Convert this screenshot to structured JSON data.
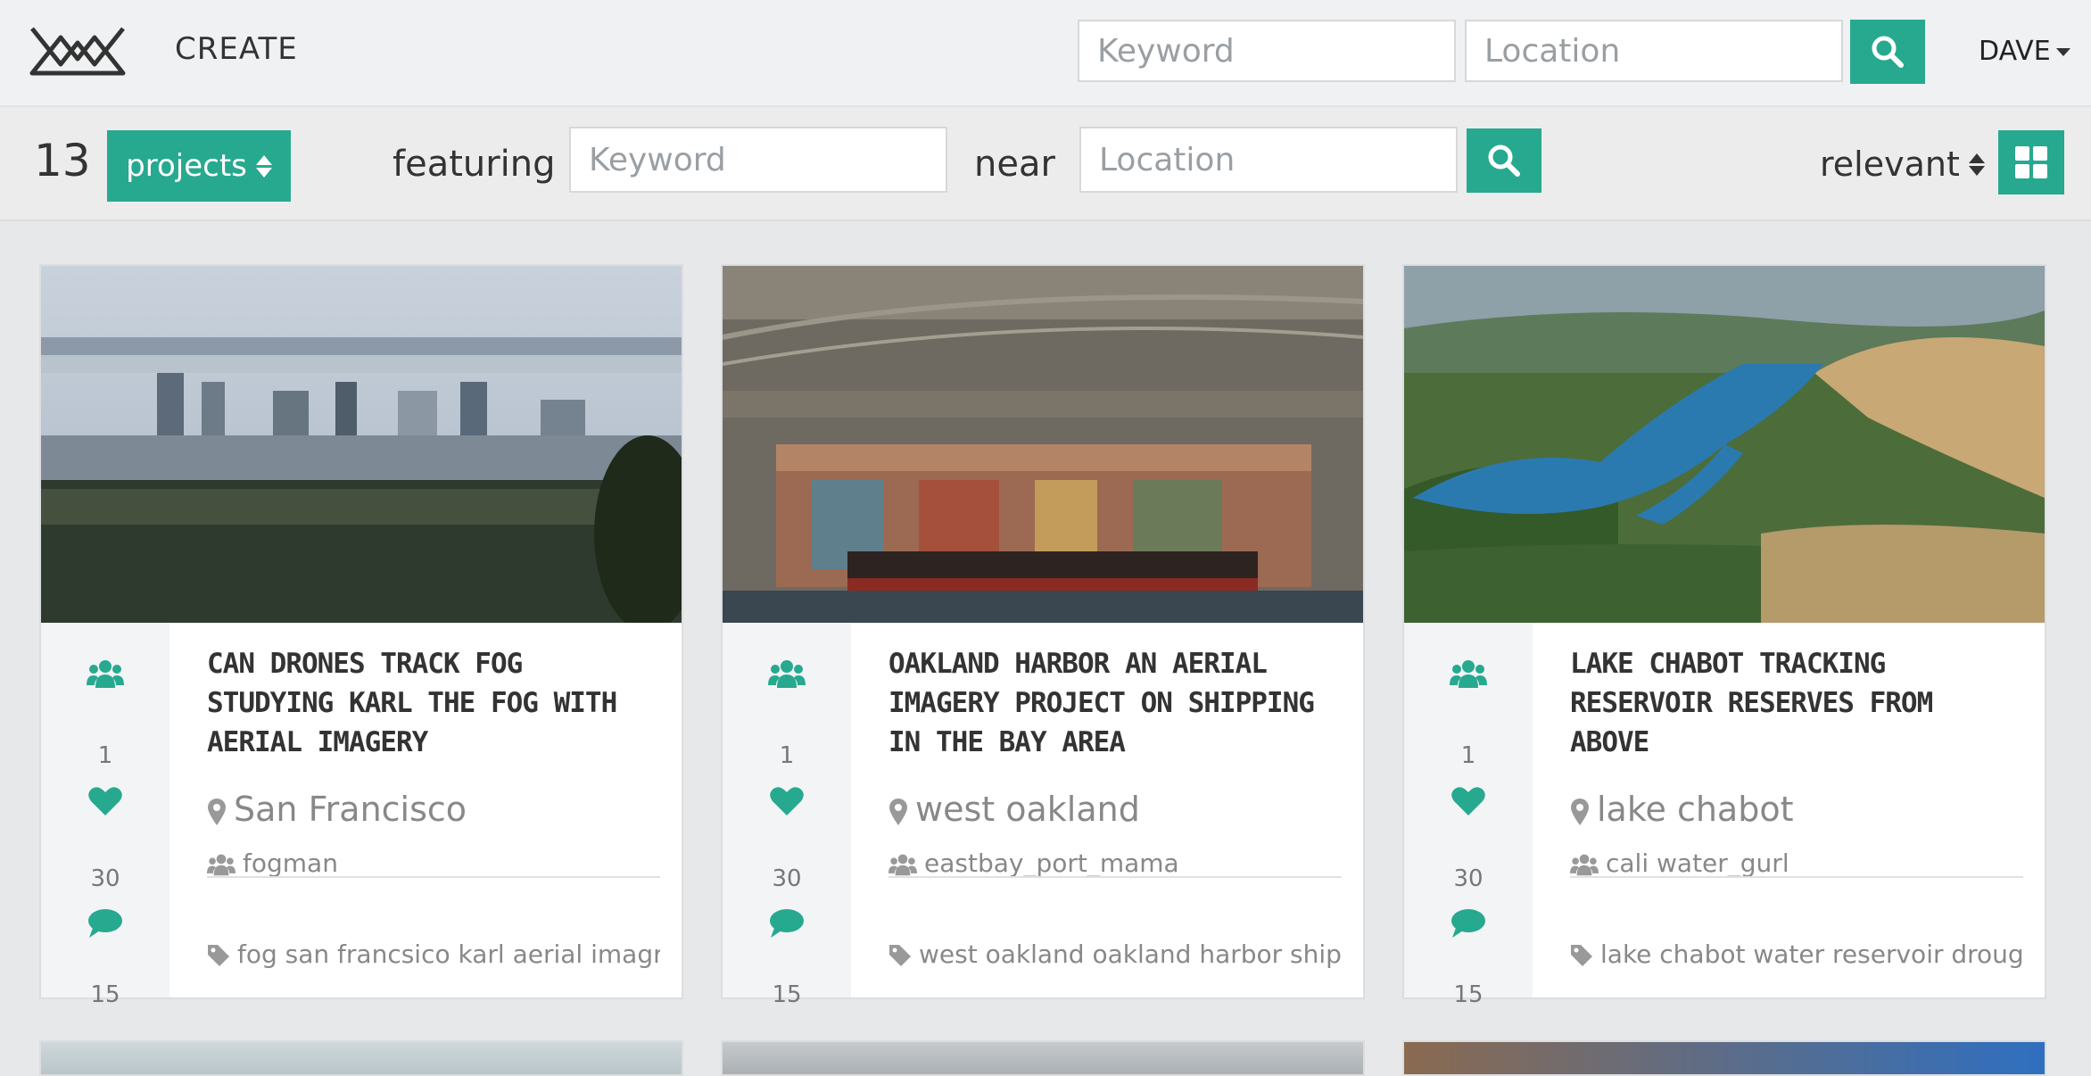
{
  "header": {
    "create_label": "CREATE",
    "search_keyword_placeholder": "Keyword",
    "search_location_placeholder": "Location",
    "user_label": "DAVE"
  },
  "filters": {
    "result_count": "13",
    "type_label": "projects",
    "featuring_label": "featuring",
    "keyword_placeholder": "Keyword",
    "near_label": "near",
    "location_placeholder": "Location",
    "sort_label": "relevant"
  },
  "colors": {
    "accent": "#27a98f",
    "background": "#e7e8e9"
  },
  "cards": [
    {
      "title": "Can drones track fog studying karl the fog with aerial imagery",
      "members": "1",
      "likes": "30",
      "comments": "15",
      "location": "San Francisco",
      "user": "fogman",
      "tags": "fog san francsico karl aerial imagry"
    },
    {
      "title": "Oakland harbor an aerial imagery project on shipping in the bay area",
      "members": "1",
      "likes": "30",
      "comments": "15",
      "location": "west oakland",
      "user": "eastbay_port_mama",
      "tags": "west oakland oakland harbor shipping"
    },
    {
      "title": "Lake chabot tracking reservoir reserves from above",
      "members": "1",
      "likes": "30",
      "comments": "15",
      "location": "lake chabot",
      "user": "cali water_gurl",
      "tags": "lake chabot water reservoir drought california"
    }
  ],
  "icons": {
    "logo": "mountain-logo-icon",
    "search": "search-icon",
    "members": "users-icon",
    "likes": "heart-icon",
    "comments": "comment-icon",
    "location": "map-marker-icon",
    "user": "users-icon",
    "tags": "tag-icon",
    "view": "grid-view-icon"
  }
}
